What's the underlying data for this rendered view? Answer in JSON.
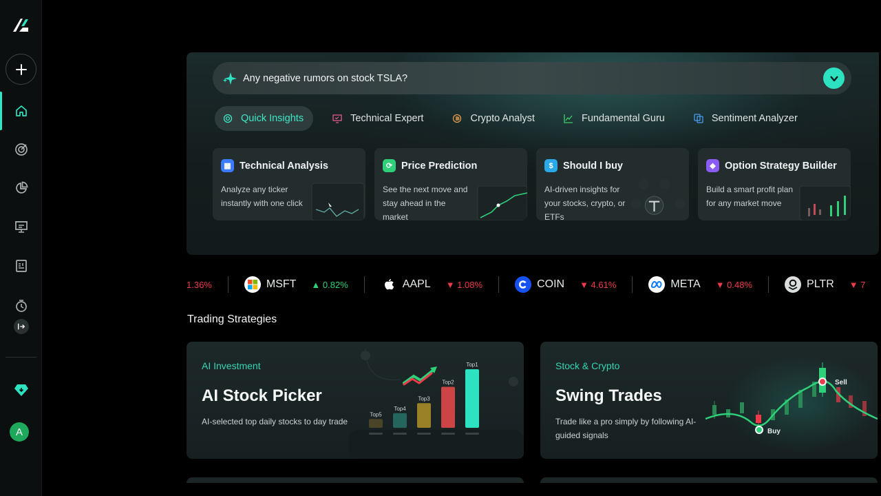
{
  "sidebar": {
    "logo": "app-logo",
    "new_chat": "plus-icon",
    "items": [
      {
        "name": "home",
        "icon": "home-icon",
        "active": true
      },
      {
        "name": "signals",
        "icon": "target-icon"
      },
      {
        "name": "portfolio",
        "icon": "pie-chart-icon"
      },
      {
        "name": "presentation",
        "icon": "presentation-icon"
      },
      {
        "name": "reports",
        "icon": "document-icon"
      },
      {
        "name": "history",
        "icon": "history-icon"
      },
      {
        "name": "collapse",
        "icon": "expand-sidebar-icon"
      }
    ],
    "premium_icon": "diamond-icon",
    "avatar_letter": "A"
  },
  "search": {
    "query": "Any negative rumors on stock TSLA?"
  },
  "tabs": [
    {
      "label": "Quick Insights",
      "icon": "target-icon",
      "active": true
    },
    {
      "label": "Technical Expert",
      "icon": "monitor-icon"
    },
    {
      "label": "Crypto Analyst",
      "icon": "coin-icon"
    },
    {
      "label": "Fundamental Guru",
      "icon": "chart-line-icon"
    },
    {
      "label": "Sentiment Analyzer",
      "icon": "copy-icon"
    }
  ],
  "quick_cards": [
    {
      "title": "Technical Analysis",
      "desc": "Analyze any ticker instantly with one click",
      "color": "#3b7bff"
    },
    {
      "title": "Price Prediction",
      "desc": "See the next move and stay ahead in the market",
      "color": "#2fd07a"
    },
    {
      "title": "Should I buy",
      "desc": "AI-driven insights for your stocks, crypto, or ETFs",
      "color": "#2ba8e8"
    },
    {
      "title": "Option Strategy Builder",
      "desc": "Build a smart profit plan for any market move",
      "color": "#8a5cf5"
    }
  ],
  "ticker": [
    {
      "symbol": "",
      "change": "1.36%",
      "dir": "down",
      "partial": true
    },
    {
      "symbol": "MSFT",
      "change": "0.82%",
      "dir": "up",
      "logo": "microsoft-logo"
    },
    {
      "symbol": "AAPL",
      "change": "1.08%",
      "dir": "down",
      "logo": "apple-logo"
    },
    {
      "symbol": "COIN",
      "change": "4.61%",
      "dir": "down",
      "logo": "coinbase-logo"
    },
    {
      "symbol": "META",
      "change": "0.48%",
      "dir": "down",
      "logo": "meta-logo"
    },
    {
      "symbol": "PLTR",
      "change": "7",
      "dir": "down",
      "logo": "palantir-logo"
    }
  ],
  "strategies": {
    "title": "Trading Strategies",
    "cards": [
      {
        "category": "AI Investment",
        "title": "AI Stock Picker",
        "desc": "AI-selected top daily stocks to day trade",
        "bars": [
          {
            "label": "Top5",
            "value": 0.15
          },
          {
            "label": "Top4",
            "value": 0.25
          },
          {
            "label": "Top3",
            "value": 0.42
          },
          {
            "label": "Top2",
            "value": 0.7
          },
          {
            "label": "Top1",
            "value": 1.0
          }
        ]
      },
      {
        "category": "Stock & Crypto",
        "title": "Swing Trades",
        "desc": "Trade like a pro simply by following AI-guided signals",
        "markers": {
          "sell": "Sell",
          "buy": "Buy"
        }
      }
    ]
  },
  "colors": {
    "accent": "#2de2c0",
    "up": "#2fd07a",
    "down": "#ee3b4a"
  }
}
